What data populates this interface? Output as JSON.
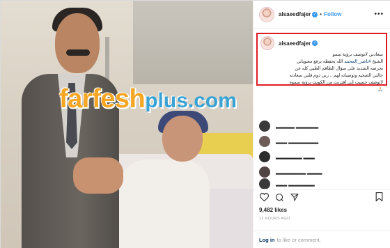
{
  "post": {
    "username": "alsaeedfajer",
    "verified_glyph": "✓",
    "follow_label": "Follow",
    "bullet": "•",
    "more_glyph": "•••",
    "watermark": {
      "main": "farfesh",
      "plus": "plus",
      "dotcom": ".com"
    }
  },
  "caption": {
    "username": "alsaeedfajer",
    "lines": [
      "سعادتي لاتوصف برؤية سمو",
      "الشيخ #ناصر_المحمد الله يحفظه برفع معنوياتي",
      "بحرصه الشديد على سؤال الطاقم الطبي كله عن",
      "حالتي الصحيه وتوصياته لهم .. ربي دوم قلبي سعادته",
      "لاتوصف حسيت إني إقتربت من الكويت برؤية سموه",
      "🙏🏻"
    ],
    "mention": "#ناصر_المحمد"
  },
  "comments": [
    {
      "text": "▂▂▂▂▂▂ ▂▂▂▂▂"
    },
    {
      "text": "▂▂▂▂▂▂▂▂ ▂▂▂"
    },
    {
      "text": "▂▂▂ ▂▂▂▂▂▂▂"
    },
    {
      "text": "▂▂▂▂ ▂▂▂▂▂▂▂▂"
    },
    {
      "text": "▂▂▂▂▂▂▂ ▂▂▂"
    }
  ],
  "stats": {
    "likes": "9,482 likes",
    "time_ago": "12 HOURS AGO"
  },
  "footer": {
    "login_link": "Log in",
    "login_rest": "to like or comment."
  },
  "icons": [
    "heart-icon",
    "comment-icon",
    "share-icon",
    "bookmark-icon",
    "verified-badge-icon",
    "more-options-icon"
  ],
  "colors": {
    "accent_blue": "#3897f0",
    "highlight_red": "#e01b22",
    "watermark_orange": "#f6a623",
    "watermark_blue": "#3aa3d6"
  }
}
